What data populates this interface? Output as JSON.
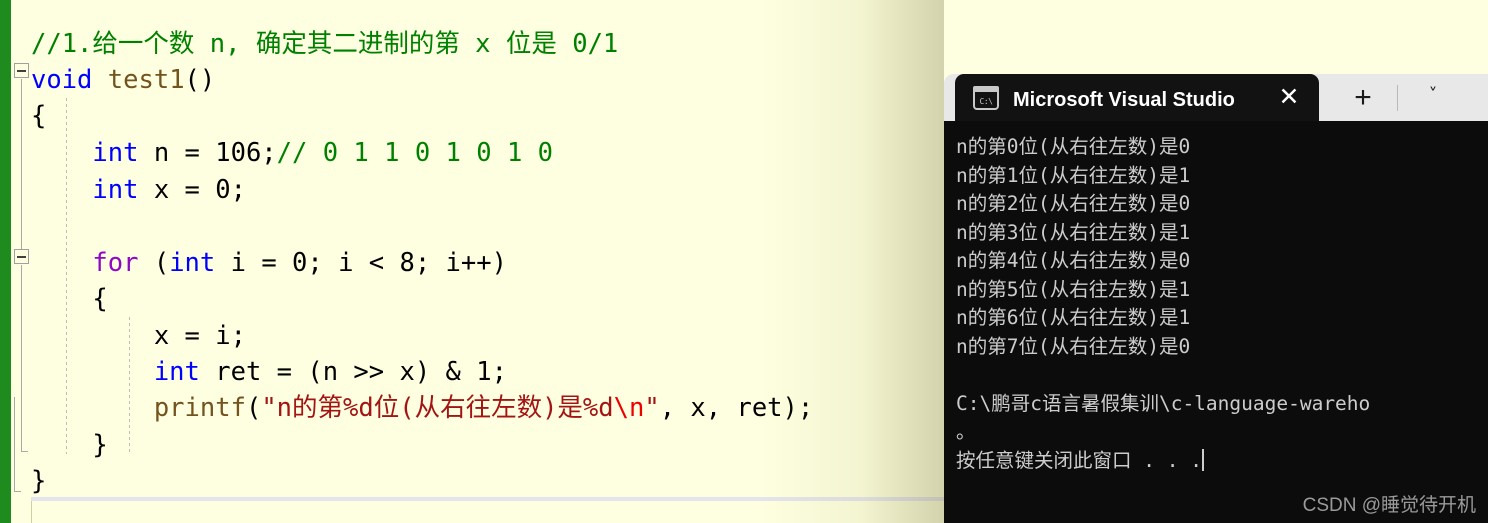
{
  "editor": {
    "background_color": "#FEFFE0",
    "change_bar_color": "#1E8B1E",
    "comment_color": "#008000",
    "keyword_color": "#0000FF",
    "control_keyword_color": "#8F08C4",
    "string_color": "#A31515",
    "escape_color": "#EE0000",
    "function_color": "#74531F",
    "lines": [
      {
        "text": "//1.给一个数 n, 确定其二进制的第 x 位是 0/1"
      },
      {
        "text": "void test1()"
      },
      {
        "text": "{"
      },
      {
        "text": "    int n = 106;// 0 1 1 0 1 0 1 0"
      },
      {
        "text": "    int x = 0;"
      },
      {
        "text": ""
      },
      {
        "text": "    for (int i = 0; i < 8; i++)"
      },
      {
        "text": "    {"
      },
      {
        "text": "        x = i;"
      },
      {
        "text": "        int ret = (n >> x) & 1;"
      },
      {
        "text": "        printf(\"n的第%d位(从右往左数)是%d\\n\", x, ret);"
      },
      {
        "text": "    }"
      },
      {
        "text": "}"
      }
    ],
    "tokens": {
      "l1_comment": "//1.给一个数 n, 确定其二进制的第 x 位是 0/1",
      "l2_kw": "void",
      "l2_space": " ",
      "l2_fn": "test1",
      "l2_paren": "()",
      "l3_brace": "{",
      "l4_indent": "    ",
      "l4_kw": "int",
      "l4_mid": " n = 106;",
      "l4_comment": "// 0 1 1 0 1 0 1 0",
      "l5_indent": "    ",
      "l5_kw": "int",
      "l5_rest": " x = 0;",
      "l7_indent": "    ",
      "l7_kw": "for",
      "l7_a": " (",
      "l7_kw2": "int",
      "l7_b": " i = 0; i < 8; i++)",
      "l8_brace": "    {",
      "l9_text": "        x = i;",
      "l10_indent": "        ",
      "l10_kw": "int",
      "l10_rest": " ret = (n >> x) & 1;",
      "l11_indent": "        ",
      "l11_fn": "printf",
      "l11_paren": "(",
      "l11_str": "\"n的第%d位(从右往左数)是%d",
      "l11_esc": "\\n",
      "l11_str2": "\"",
      "l11_tail": ", x, ret);",
      "l12_brace": "    }",
      "l13_brace": "}"
    }
  },
  "terminal": {
    "tab": {
      "icon": "console-icon",
      "icon_label": "C:\\",
      "title": "Microsoft Visual Studio 调试控",
      "close_label": "✕"
    },
    "new_tab_label": "+",
    "dropdown_label": "˅",
    "background_color": "#0C0C0C",
    "foreground_color": "#CCCCCC",
    "output_lines": [
      "n的第0位(从右往左数)是0",
      "n的第1位(从右往左数)是1",
      "n的第2位(从右往左数)是0",
      "n的第3位(从右往左数)是1",
      "n的第4位(从右往左数)是0",
      "n的第5位(从右往左数)是1",
      "n的第6位(从右往左数)是1",
      "n的第7位(从右往左数)是0",
      "",
      "C:\\鹏哥c语言暑假集训\\c-language-wareho",
      "。",
      "按任意键关闭此窗口 . . ."
    ],
    "output_block_a": "n的第0位(从右往左数)是0\nn的第1位(从右往左数)是1\nn的第2位(从右往左数)是0\nn的第3位(从右往左数)是1\nn的第4位(从右往左数)是0\nn的第5位(从右往左数)是1\nn的第6位(从右往左数)是1\nn的第7位(从右往左数)是0\n\nC:\\鹏哥c语言暑假集训\\c-language-wareho\n。\n按任意键关闭此窗口 . . .",
    "watermark": "CSDN @睡觉待开机"
  }
}
